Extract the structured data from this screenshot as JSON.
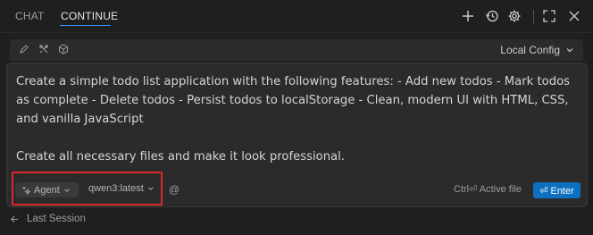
{
  "tabs": [
    {
      "label": "CHAT",
      "active": false
    },
    {
      "label": "CONTINUE",
      "active": true
    }
  ],
  "toolbar_icons": [
    "plus-icon",
    "history-icon",
    "gear-icon",
    "fullscreen-icon",
    "close-icon"
  ],
  "config": {
    "icons": [
      "pencil-icon",
      "tools-icon",
      "cube-icon"
    ],
    "selected": "Local Config"
  },
  "prompt": {
    "paragraph1": "Create a simple todo list application with the following features: - Add new todos - Mark todos as complete - Delete todos - Persist todos to localStorage - Clean, modern UI with HTML, CSS, and vanilla JavaScript",
    "paragraph2": "Create all necessary files and make it look professional."
  },
  "input_bar": {
    "mode": "Agent",
    "model": "qwen3:latest",
    "mention": "@",
    "shortcut_hint": "Ctrl⏎ Active file",
    "enter_label": "⏎ Enter"
  },
  "footer": {
    "last_session": "Last Session"
  },
  "colors": {
    "accent": "#3794ff",
    "enter_button": "#0e70c0",
    "highlight_box": "#d9292e"
  }
}
